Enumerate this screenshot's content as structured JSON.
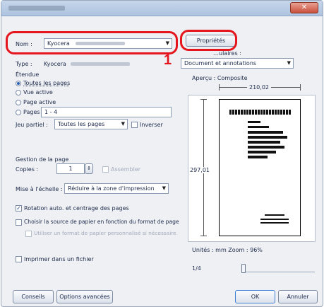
{
  "dialog": {
    "close_glyph": "✕"
  },
  "printer": {
    "name_label": "Nom :",
    "name_value": "Kyocera",
    "type_label": "Type :",
    "type_value": "Kyocera",
    "properties_button": "Propriétés",
    "comments_label": "…ulaires :",
    "comments_value": "Document et annotations",
    "callout_number": "1"
  },
  "range": {
    "section_label": "Étendue",
    "all_pages": "Toutes les pages",
    "current_view": "Vue active",
    "current_page": "Page active",
    "pages_label": "Pages",
    "pages_value": "1 - 4",
    "subset_label": "Jeu partiel :",
    "subset_value": "Toutes les pages",
    "reverse_label": "Inverser"
  },
  "handling": {
    "section_label": "Gestion de la page",
    "copies_label": "Copies :",
    "copies_value": "1",
    "collate_label": "Assembler",
    "scaling_label": "Mise à l'échelle :",
    "scaling_value": "Réduire à la zone d'impression",
    "auto_rotate_label": "Rotation auto. et centrage des pages",
    "paper_source_label": "Choisir la source de papier en fonction du format de page",
    "custom_paper_label": "Utiliser un format de papier personnalisé si nécessaire"
  },
  "print_to_file_label": "Imprimer dans un fichier",
  "preview": {
    "label": "Aperçu : Composite",
    "width_value": "210,02",
    "height_value": "297,01",
    "units_zoom": "Unités : mm Zoom : 96%",
    "page_counter": "1/4"
  },
  "footer": {
    "tips_button": "Conseils",
    "advanced_button": "Options avancées",
    "ok_button": "OK",
    "cancel_button": "Annuler"
  },
  "colors": {
    "highlight": "#e5151d",
    "radio_selected": "#2a5fb3"
  }
}
